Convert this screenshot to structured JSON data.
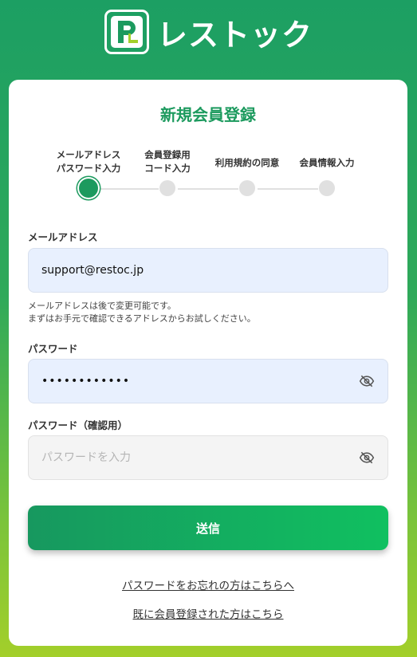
{
  "brand": {
    "name": "レストック",
    "logo_icon": "parking-p-logo-icon"
  },
  "form": {
    "title": "新規会員登録",
    "steps": [
      {
        "label_line1": "メールアドレス",
        "label_line2": "パスワード入力",
        "active": true
      },
      {
        "label_line1": "会員登録用",
        "label_line2": "コード入力",
        "active": false
      },
      {
        "label_line1": "利用規約の同意",
        "label_line2": "",
        "active": false
      },
      {
        "label_line1": "会員情報入力",
        "label_line2": "",
        "active": false
      }
    ],
    "email": {
      "label": "メールアドレス",
      "value": "support@restoc.jp"
    },
    "email_hint": {
      "line1": "メールアドレスは後で変更可能です。",
      "line2": "まずはお手元で確認できるアドレスからお試しください。"
    },
    "password": {
      "label": "パスワード",
      "value": "••••••••••••",
      "icon": "eye-slash-icon"
    },
    "password_confirm": {
      "label": "パスワード（確認用）",
      "placeholder": "パスワードを入力",
      "icon": "eye-slash-icon"
    },
    "submit_label": "送信",
    "forgot_link": "パスワードをお忘れの方はこちらへ",
    "login_link": "既に会員登録された方はこちら"
  },
  "colors": {
    "accent": "#1c9a5e",
    "step_inactive": "#e0e0e0",
    "input_filled": "#e8f0fe"
  }
}
